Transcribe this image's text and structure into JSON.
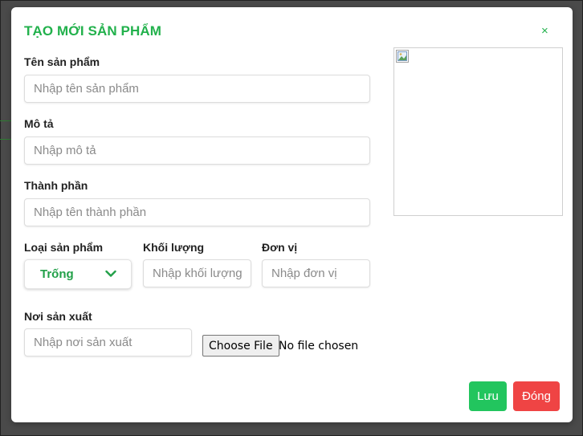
{
  "modal": {
    "title": "TẠO MỚI SẢN PHẨM",
    "close_glyph": "×"
  },
  "form": {
    "name": {
      "label": "Tên sản phẩm",
      "placeholder": "Nhập tên sản phẩm",
      "value": ""
    },
    "description": {
      "label": "Mô tả",
      "placeholder": "Nhập mô tả",
      "value": ""
    },
    "ingredients": {
      "label": "Thành phần",
      "placeholder": "Nhập tên thành phần",
      "value": ""
    },
    "category": {
      "label": "Loại sản phẩm",
      "selected": "Trống"
    },
    "weight": {
      "label": "Khối lượng",
      "placeholder": "Nhập khối lượng",
      "value": ""
    },
    "unit": {
      "label": "Đơn vị",
      "placeholder": "Nhập đơn vị",
      "value": ""
    },
    "origin": {
      "label": "Nơi sản xuất",
      "placeholder": "Nhập nơi sản xuất",
      "value": ""
    },
    "file": {
      "button_label": "Choose File",
      "status": "No file chosen"
    }
  },
  "actions": {
    "save_label": "Lưu",
    "close_label": "Đóng"
  },
  "colors": {
    "accent": "#22b14c",
    "save": "#22c55e",
    "close": "#ef4444"
  }
}
